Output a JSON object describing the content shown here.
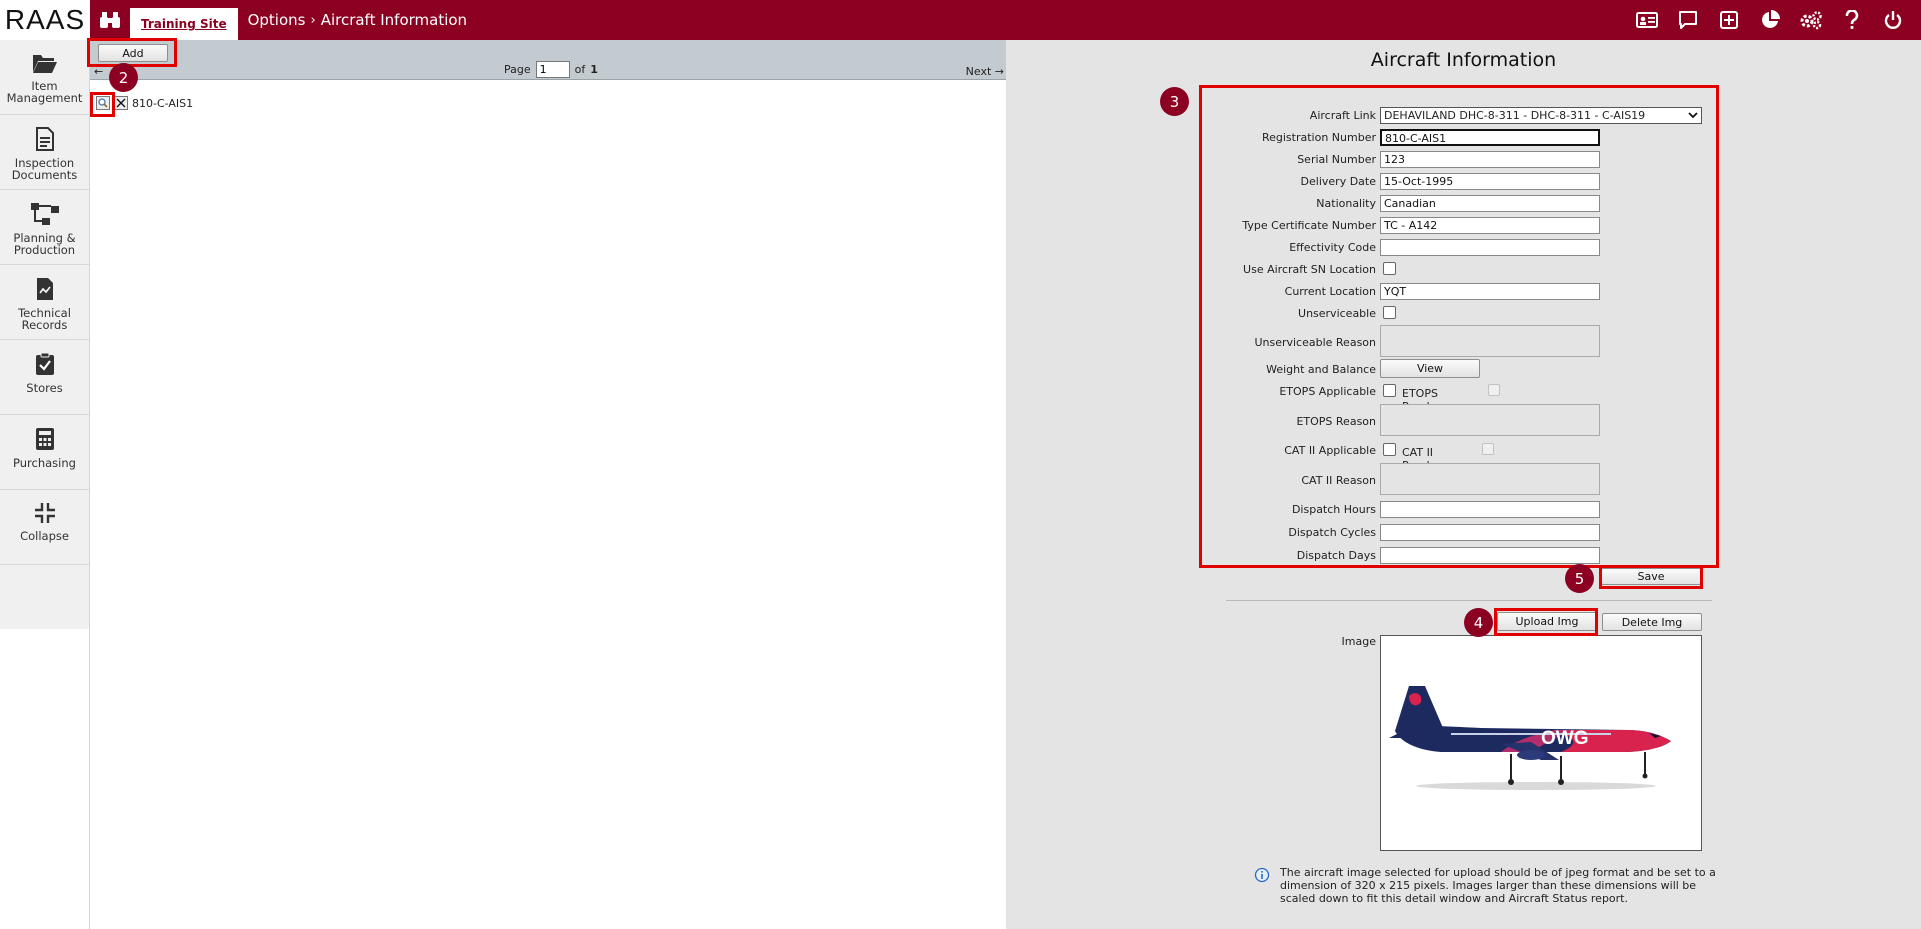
{
  "app": {
    "logo": "RAAS"
  },
  "header": {
    "site_tab": "Training Site",
    "breadcrumb": [
      "Options",
      "Aircraft Information"
    ]
  },
  "sidebar": {
    "items": [
      {
        "label1": "Item",
        "label2": "Management",
        "icon": "folder-icon"
      },
      {
        "label1": "Inspection",
        "label2": "Documents",
        "icon": "document-icon"
      },
      {
        "label1": "Planning &",
        "label2": "Production",
        "icon": "flowchart-icon"
      },
      {
        "label1": "Technical",
        "label2": "Records",
        "icon": "records-icon"
      },
      {
        "label1": "Stores",
        "label2": "",
        "icon": "clipboard-check-icon"
      },
      {
        "label1": "Purchasing",
        "label2": "",
        "icon": "calculator-icon"
      },
      {
        "label1": "Collapse",
        "label2": "",
        "icon": "collapse-icon"
      }
    ]
  },
  "list": {
    "add_label": "Add",
    "page_label": "Page",
    "page_value": "1",
    "of_label": "of",
    "page_total": "1",
    "prev_label": "←",
    "next_label": "Next →",
    "rows": [
      {
        "name": "810-C-AIS1"
      }
    ]
  },
  "detail": {
    "title": "Aircraft Information",
    "aircraft_link_label": "Aircraft Link",
    "aircraft_link_value": "DEHAVILAND DHC-8-311 - DHC-8-311 - C-AIS19",
    "registration_label": "Registration Number",
    "registration_value": "810-C-AIS1",
    "serial_label": "Serial Number",
    "serial_value": "123",
    "delivery_label": "Delivery Date",
    "delivery_value": "15-Oct-1995",
    "nationality_label": "Nationality",
    "nationality_value": "Canadian",
    "type_cert_label": "Type Certificate Number",
    "type_cert_value": "TC - A142",
    "effectivity_label": "Effectivity Code",
    "effectivity_value": "",
    "use_sn_label": "Use Aircraft SN Location",
    "current_loc_label": "Current Location",
    "current_loc_value": "YQT",
    "unserviceable_label": "Unserviceable",
    "unserviceable_reason_label": "Unserviceable Reason",
    "weight_label": "Weight and Balance",
    "view_label": "View",
    "etops_label": "ETOPS Applicable",
    "etops_ready_label": "ETOPS Ready",
    "etops_reason_label": "ETOPS Reason",
    "cat2_label": "CAT II Applicable",
    "cat2_ready_label": "CAT II Ready",
    "cat2_reason_label": "CAT II Reason",
    "dispatch_hours_label": "Dispatch Hours",
    "dispatch_cycles_label": "Dispatch Cycles",
    "dispatch_days_label": "Dispatch Days",
    "save_label": "Save",
    "upload_label": "Upload Img",
    "delete_label": "Delete Img",
    "image_label": "Image",
    "livery_text": "OWG",
    "note": "The aircraft image selected for upload should be of jpeg format and be set to a dimension of 320 x 215 pixels. Images larger than these dimensions will be scaled down to fit this detail window and Aircraft Status report."
  },
  "annotations": [
    "2",
    "3",
    "4",
    "5"
  ],
  "colors": {
    "brand": "#8c0021",
    "highlight": "#e00000"
  }
}
